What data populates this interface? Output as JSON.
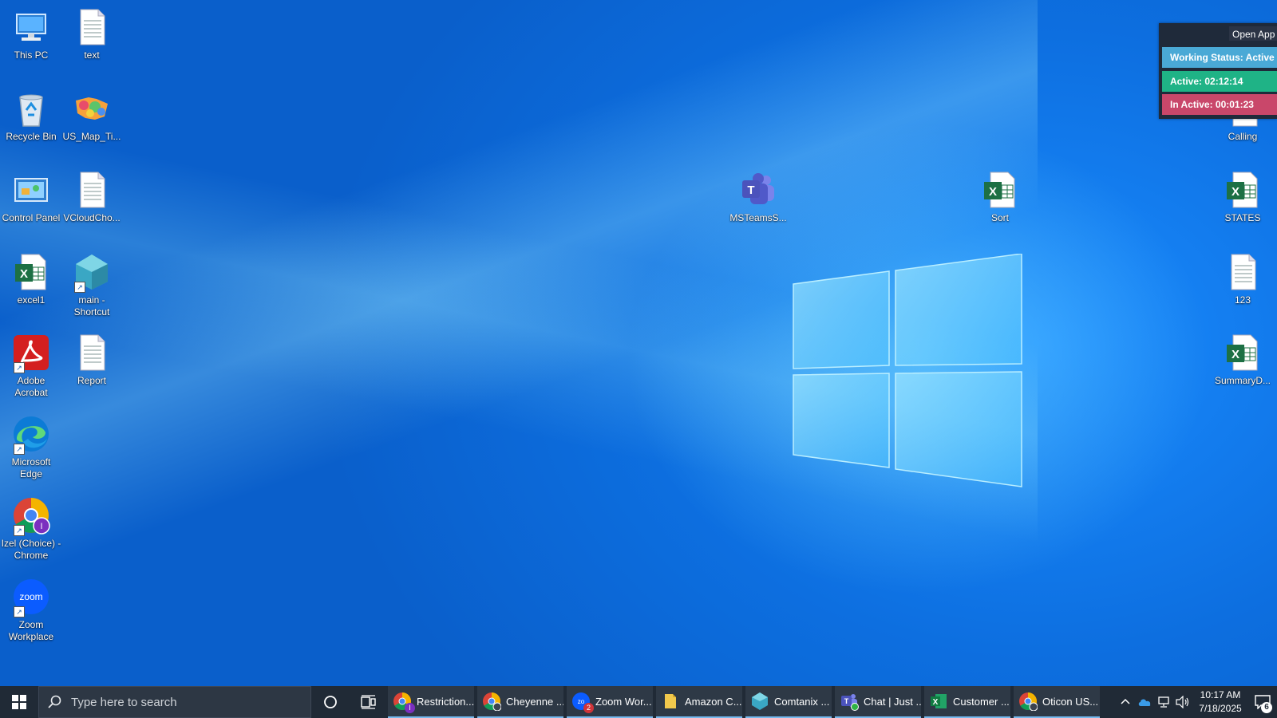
{
  "desktop": {
    "icons_left": [
      {
        "label": "This PC",
        "icon": "this-pc-icon"
      },
      {
        "label": "text",
        "icon": "text-document-icon"
      },
      {
        "label": "Recycle Bin",
        "icon": "recycle-bin-icon"
      },
      {
        "label": "US_Map_Ti...",
        "icon": "image-file-icon"
      },
      {
        "label": "Control Panel",
        "icon": "control-panel-icon"
      },
      {
        "label": "VCloudCho...",
        "icon": "text-document-icon"
      },
      {
        "label": "excel1",
        "icon": "excel-file-icon"
      },
      {
        "label": "main - Shortcut",
        "icon": "main-shortcut-icon"
      },
      {
        "label": "Adobe Acrobat",
        "icon": "adobe-acrobat-icon"
      },
      {
        "label": "Report",
        "icon": "text-document-icon"
      },
      {
        "label": "Microsoft Edge",
        "icon": "edge-icon"
      },
      {
        "label": "Izel (Choice) - Chrome",
        "icon": "chrome-profile-icon"
      },
      {
        "label": "Zoom Workplace",
        "icon": "zoom-icon"
      }
    ],
    "icons_right": [
      {
        "label": "MSTeamsS...",
        "icon": "teams-icon"
      },
      {
        "label": "Sort",
        "icon": "excel-file-icon"
      },
      {
        "label": "Calling",
        "icon": "excel-file-icon"
      },
      {
        "label": "STATES",
        "icon": "excel-file-icon"
      },
      {
        "label": "123",
        "icon": "text-document-icon"
      },
      {
        "label": "SummaryD...",
        "icon": "excel-file-icon"
      }
    ]
  },
  "status_panel": {
    "open_app_label": "Open App",
    "working_status": "Working Status: Active",
    "active": "Active: 02:12:14",
    "inactive": "In Active: 00:01:23"
  },
  "taskbar": {
    "search_placeholder": "Type here to search",
    "apps": [
      {
        "label": "Restriction...",
        "icon": "chrome-icon",
        "badge": "I",
        "badge_color": "#7b2fbf"
      },
      {
        "label": "Cheyenne ...",
        "icon": "chrome-icon",
        "badge": "",
        "badge_color": "#3c4350"
      },
      {
        "label": "Zoom Wor...",
        "icon": "zoom-icon",
        "badge": "2",
        "badge_color": "#d13438"
      },
      {
        "label": "Amazon C...",
        "icon": "folder-icon",
        "badge": "",
        "badge_color": ""
      },
      {
        "label": "Comtanix ...",
        "icon": "comtanix-icon",
        "badge": "",
        "badge_color": ""
      },
      {
        "label": "Chat | Just ...",
        "icon": "teams-icon",
        "badge": "",
        "badge_color": "#2fb344"
      },
      {
        "label": "Customer ...",
        "icon": "excel-icon",
        "badge": "",
        "badge_color": ""
      },
      {
        "label": "Oticon US...",
        "icon": "chrome-icon",
        "badge": "",
        "badge_color": "#3c4350"
      }
    ],
    "clock_time": "10:17 AM",
    "clock_date": "7/18/2025",
    "notification_count": "6"
  },
  "colors": {
    "taskbar_bg": "#202a36",
    "working_status": "#4aa9d6",
    "active": "#1fb386",
    "inactive": "#c9476a"
  }
}
